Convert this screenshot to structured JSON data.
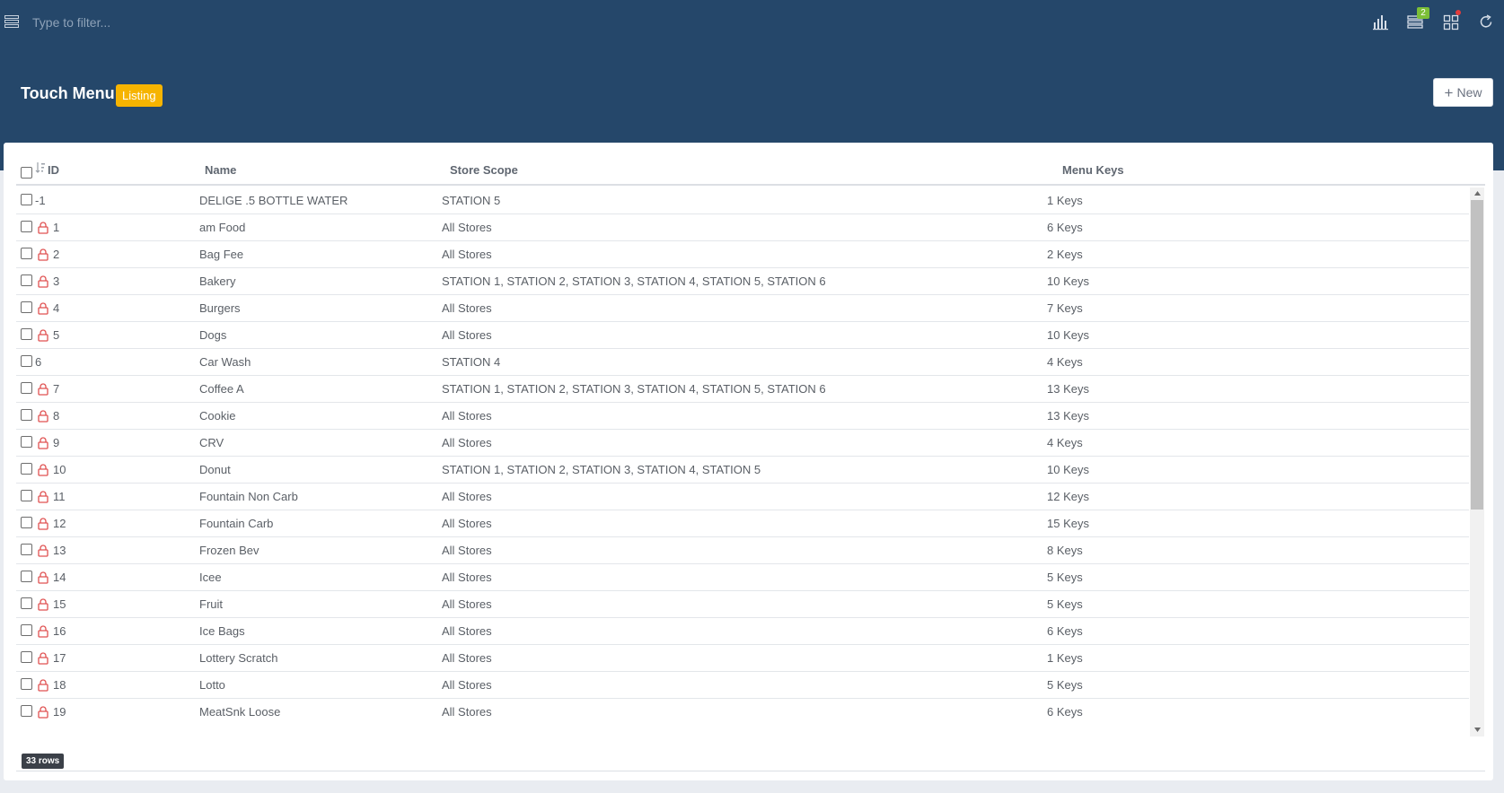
{
  "topbar": {
    "filter_placeholder": "Type to filter...",
    "notification_count": "2",
    "icons": [
      "menu-icon",
      "bar-chart-icon",
      "list-icon",
      "grid-icon",
      "refresh-icon"
    ]
  },
  "header": {
    "title": "Touch Menu",
    "badge": "Listing",
    "new_button_label": "New"
  },
  "colors": {
    "header_bg": "#25476a",
    "badge_bg": "#f6b400",
    "lock_icon": "#e05252",
    "notification_badge": "#7cbf37"
  },
  "table": {
    "columns": {
      "id": "ID",
      "name": "Name",
      "scope": "Store Scope",
      "keys": "Menu Keys"
    },
    "rows": [
      {
        "id": "-1",
        "locked": false,
        "name": "DELIGE .5 BOTTLE WATER",
        "scope": "STATION 5",
        "keys": "1 Keys"
      },
      {
        "id": "1",
        "locked": true,
        "name": "am Food",
        "scope": "All Stores",
        "keys": "6 Keys"
      },
      {
        "id": "2",
        "locked": true,
        "name": "Bag Fee",
        "scope": "All Stores",
        "keys": "2 Keys"
      },
      {
        "id": "3",
        "locked": true,
        "name": "Bakery",
        "scope": "STATION 1, STATION 2, STATION 3, STATION 4, STATION 5, STATION 6",
        "keys": "10 Keys"
      },
      {
        "id": "4",
        "locked": true,
        "name": "Burgers",
        "scope": "All Stores",
        "keys": "7 Keys"
      },
      {
        "id": "5",
        "locked": true,
        "name": "Dogs",
        "scope": "All Stores",
        "keys": "10 Keys"
      },
      {
        "id": "6",
        "locked": false,
        "name": "Car Wash",
        "scope": "STATION 4",
        "keys": "4 Keys"
      },
      {
        "id": "7",
        "locked": true,
        "name": "Coffee A",
        "scope": "STATION 1, STATION 2, STATION 3, STATION 4, STATION 5, STATION 6",
        "keys": "13 Keys"
      },
      {
        "id": "8",
        "locked": true,
        "name": "Cookie",
        "scope": "All Stores",
        "keys": "13 Keys"
      },
      {
        "id": "9",
        "locked": true,
        "name": "CRV",
        "scope": "All Stores",
        "keys": "4 Keys"
      },
      {
        "id": "10",
        "locked": true,
        "name": "Donut",
        "scope": "STATION 1, STATION 2, STATION 3, STATION 4, STATION 5",
        "keys": "10 Keys"
      },
      {
        "id": "11",
        "locked": true,
        "name": "Fountain Non Carb",
        "scope": "All Stores",
        "keys": "12 Keys"
      },
      {
        "id": "12",
        "locked": true,
        "name": "Fountain Carb",
        "scope": "All Stores",
        "keys": "15 Keys"
      },
      {
        "id": "13",
        "locked": true,
        "name": "Frozen Bev",
        "scope": "All Stores",
        "keys": "8 Keys"
      },
      {
        "id": "14",
        "locked": true,
        "name": "Icee",
        "scope": "All Stores",
        "keys": "5 Keys"
      },
      {
        "id": "15",
        "locked": true,
        "name": "Fruit",
        "scope": "All Stores",
        "keys": "5 Keys"
      },
      {
        "id": "16",
        "locked": true,
        "name": "Ice Bags",
        "scope": "All Stores",
        "keys": "6 Keys"
      },
      {
        "id": "17",
        "locked": true,
        "name": "Lottery Scratch",
        "scope": "All Stores",
        "keys": "1 Keys"
      },
      {
        "id": "18",
        "locked": true,
        "name": "Lotto",
        "scope": "All Stores",
        "keys": "5 Keys"
      },
      {
        "id": "19",
        "locked": true,
        "name": "MeatSnk Loose",
        "scope": "All Stores",
        "keys": "6 Keys"
      }
    ]
  },
  "footer": {
    "row_count": "33 rows"
  }
}
